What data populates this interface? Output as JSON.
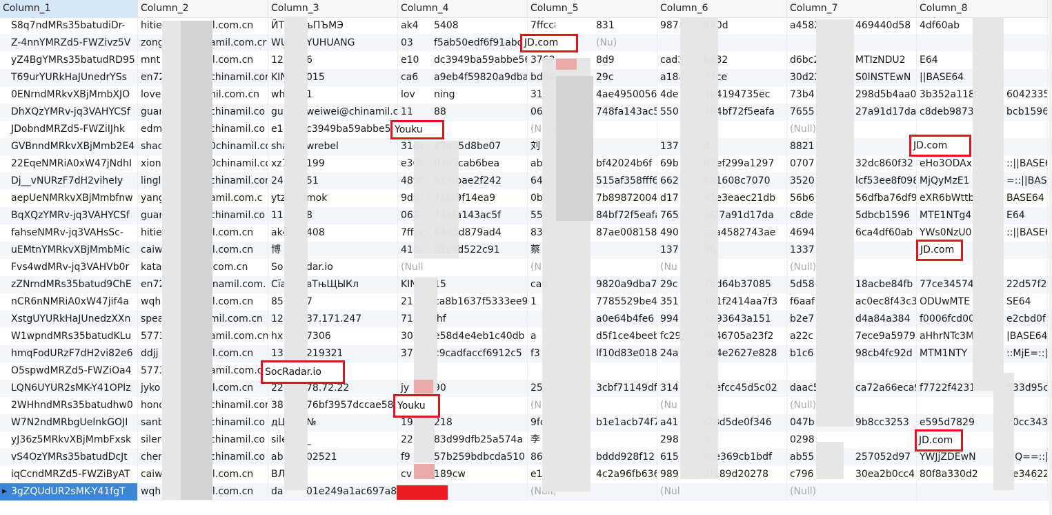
{
  "columns": [
    "Column_1",
    "Column_2",
    "Column_3",
    "Column_4",
    "Column_5",
    "Column_6",
    "Column_7",
    "Column_8",
    ""
  ],
  "rows": [
    [
      "S8q7ndMRs35batudiDr-",
      "hitie",
      "il.com.cn",
      "ЙТ",
      "ъПЪМЭ",
      "ak4",
      "5408",
      "7ffcc8106276403d879ad4",
      "831",
      "987ae0081582",
      "490d",
      "a4582743ae",
      "469440d58",
      "4df60ab"
    ],
    [
      "Z-4nnYMRZd5-FWZivz5V",
      "zong",
      "amil.com.cr",
      "WU",
      "YUHUANG",
      "03",
      "f5ab50edf6f91abd8",
      "",
      "(Nu)",
      "",
      "",
      "",
      "",
      ""
    ],
    [
      "yZ4BgYMRs35batudRD95",
      "mnt",
      "il.com.cn",
      "12",
      "6",
      "e10",
      "dc3949ba59abbe56e",
      "3762af61e59",
      "8d9",
      "cad3c29a3a62",
      "ba32",
      "d6bc22d4a6",
      "MTIzNDU2",
      "E64"
    ],
    [
      "T69urYURkHaJUnedrYSs",
      "en72",
      "chinamil.com.",
      "KIN",
      "015",
      "ca6",
      "a9eb4f59820a9dba7",
      "bd64b37085",
      "29c",
      "a18acbe84fb",
      "77ce",
      "30d22d57f2",
      "S0lNSTEwN",
      "||BASE64"
    ],
    [
      "0ENrndMRkvXBjMmbXJO",
      "love",
      "nil.com.cn",
      "wh",
      "1",
      "lov",
      "ning",
      "31",
      "4ae49500569",
      "4de",
      "4b4194735ec",
      "73b4",
      "298d5b4aa0",
      "3b352a118",
      "6042335b"
    ],
    [
      "DhXQzYMRv-jq3VAHYCSf",
      "guar",
      "chinamil.co",
      "gu",
      "weiwei@chinamil.co",
      "11",
      "88",
      "06",
      "748fa143ac5f",
      "550",
      "784bf72f5eafa",
      "7655",
      "27a91d17da",
      "c8deb9873",
      "bcb1596"
    ],
    [
      "JDobndMRZd5-FWZiIJhk",
      "edm",
      "chinamil.co",
      "e1",
      "c3949ba59abbe56e",
      "",
      "",
      "(Null)",
      "",
      "",
      "",
      "(Null)",
      "",
      ""
    ],
    [
      "GVBnndMRkvXBjMmb2E4",
      "shac",
      "0chinamil.co",
      "sha",
      "wrebel",
      "316a",
      "49a65d8be07",
      "刘",
      "",
      "137",
      "4",
      "8821",
      "",
      ""
    ],
    [
      "22EqeNMRiA0xW47jNdhI",
      "xion",
      "0chinamil.co",
      "xz7",
      "199",
      "e30c",
      "8aa9cab6bea",
      "ab",
      "bf42024b6f",
      "69b",
      "07ef299a1297",
      "0707",
      "32dc860f32",
      "eHo3ODAx",
      "::||BASE64"
    ],
    [
      "Dj__vNURzF7dH2viheIy",
      "lingl",
      "chinamil.com",
      "24",
      "51",
      "4895",
      "a17fbae2f242",
      "64",
      "515af358fff6",
      "662",
      "e81608c7070",
      "3520",
      "lcf53ee8f098",
      "MjQyMzE1",
      "=::||BASE6"
    ],
    [
      "aepUeNMRkvXBjMmbfnw",
      "yang",
      "amil.com.c",
      "ytz",
      "mok",
      "9db3",
      "78fa9f14ea9",
      "0b",
      "7b89872004C",
      "d17",
      "a1e3eaec21db",
      "56b6",
      "56dfba76df9",
      "eXR6bWttb",
      "BASE64"
    ],
    [
      "BqXQzYMRv-jq3VAHYCSf",
      "guar",
      "chinamil.co",
      "11",
      "8",
      "062c",
      "748fa143ac5f",
      "55",
      "84bf72f5eafa",
      "765",
      "af27a91d17da",
      "c8de",
      "5dbcb1596",
      "MTE1NTg4",
      "E64"
    ],
    [
      "fahseNMRv-jq3VAHsSc-",
      "hitie",
      "il.com.cn",
      "ak4",
      "408",
      "7ffcc",
      "6403d879ad4",
      "83",
      "87ae0081582",
      "490",
      "caa4582743ae",
      "4694",
      "6ca4df60ab",
      "YWs0NzU0",
      "::||BASE6"
    ],
    [
      "uEMtnYMRkvXBjMmbMic",
      "caiw",
      "il.com.cn",
      "博",
      "",
      "41b0",
      "01c9d522c91",
      "蔡",
      "",
      "137",
      "96",
      "1337",
      "",
      ""
    ],
    [
      "Fvs4wdMRv-jq3VAHVb0r",
      "kata",
      ".com.cn",
      "So",
      "dar.io",
      "(Null)",
      "",
      "(Nu",
      "",
      "(Nu",
      "",
      "(Null)",
      "",
      ""
    ],
    [
      "zZNrndMRs35batud9ChE",
      "en72",
      "inamil.com.",
      "Сīа",
      "вТњЩЫКл",
      "KIN",
      "15",
      "ca6",
      "9820a9dba7",
      "29c",
      "7bd64b37085",
      "5d58",
      "18acbe84fb",
      "77ce34574",
      "22d57f2"
    ],
    [
      "nCR6nNMRiA0xW47jif4a",
      "wqh",
      "il.com.cn",
      "85",
      "7",
      "21",
      "ca8b1637f5333ee9",
      "1",
      "7785529be47",
      "351",
      "171f2414aa7f3",
      "f6aaf",
      "ac0ec8f43c3",
      "ODUwMTE",
      "SE64"
    ],
    [
      "XstgUYURkHaJUnedzXXn",
      "spea",
      "mil.com.cn",
      "12",
      "37.171.247",
      "71",
      "lhf",
      "",
      "a0e64b4fe6",
      "994",
      "1193643a151",
      "b2e7",
      "d4a84a384",
      "f0006fcd00",
      "e2cbd0f"
    ],
    [
      "W1wpndMRs35batudKLu",
      "5773",
      "amil.com.cn",
      "hx",
      "7306",
      "30",
      "e58d4e4eb1c40db",
      "a",
      "d5f1ce4beeb",
      "fc29",
      "c446705a23f2",
      "a22c",
      "7ece9a5979",
      "aHhrNTc3M",
      "|BASE64"
    ],
    [
      "hmqFodURzF7dH2vi82e6",
      "ddjj",
      "il.com.cn",
      "13",
      "219321",
      "37",
      "c9cadfaccf6912c5",
      "f3",
      "lf10d83e018",
      "24a",
      "304e2627e828",
      "b1c6",
      "98cb4fc92d",
      "MTM1NTY",
      "::MjE=::||"
    ],
    [
      "O5spwdMRZd5-FWZiOa4",
      "5773",
      "amil.com.cn",
      "",
      "",
      "",
      "",
      "",
      "",
      "",
      "",
      "",
      "",
      ""
    ],
    [
      "LQN6UYUR2sMK-Y41OPIz",
      "jyko",
      "il.com.cn",
      "22",
      "78.72.22",
      "jy",
      "90",
      "25",
      "3cbf71149df",
      "314",
      "7cefcc45d5c02",
      "daac5",
      "ca72a66eca9",
      "f7722f4231",
      "533d95c5"
    ],
    [
      "2WHhndMRs35batudhw0",
      "hono",
      "chinamil.com",
      "38",
      "76bf3957dccae587",
      "",
      "",
      "(Null)",
      "",
      "(Nu",
      "",
      "(Null)",
      "",
      ""
    ],
    [
      "W7N2ndMRbgUelnkGOJI",
      "sanb",
      "chinamil.co",
      "дЦ",
      "№",
      "19",
      "218",
      "9fc",
      "b1e1acb74f7",
      "a41",
      "f28d5de0f346",
      "047b",
      "9b8cc3253",
      "e595d7829",
      "70cc343"
    ],
    [
      "yJ36z5MRkvXBjMmbFxsk",
      "silen",
      "chinamil.co",
      "sile",
      "_",
      "22",
      "83d99dfb25a574a",
      "李",
      "",
      "298",
      "5",
      "0298",
      "",
      ""
    ],
    [
      "vS4OzYMRs35batudDcJt",
      "chen",
      "chinamil.co",
      "ab",
      "02521",
      "f9",
      "57b259bdbcda510",
      "86",
      "bddd928f12",
      "615",
      "cce369cb1bdf",
      "ab55",
      "257052d97",
      "YWJjZDEwN",
      "MQ==::||B"
    ],
    [
      "iqCcndMRZd5-FWZiByAT",
      "caiw",
      "il.com.cn",
      "ВЛ",
      "",
      "cv",
      "189cw",
      "e1",
      "4c2a96fb636",
      "989",
      "2f189d20278",
      "c796",
      "30ea2b0cc4",
      "80f8a330d2",
      "3e34622"
    ],
    [
      "3gZQUdUR2sMK-Y41fgT",
      "wqh",
      "il.com.cn",
      "da",
      "01e249a1ac697a8",
      "",
      "",
      "(Null)",
      "",
      "(Null)",
      "",
      "(Null)",
      "",
      ""
    ]
  ],
  "highlights": [
    {
      "label": "JD.com"
    },
    {
      "label": "Youku"
    },
    {
      "label": "JD.com"
    },
    {
      "label": "JD.com"
    },
    {
      "label": "SocRadar.io"
    },
    {
      "label": "Youku"
    },
    {
      "label": "JD.com"
    }
  ],
  "cursor_marker": "▶"
}
